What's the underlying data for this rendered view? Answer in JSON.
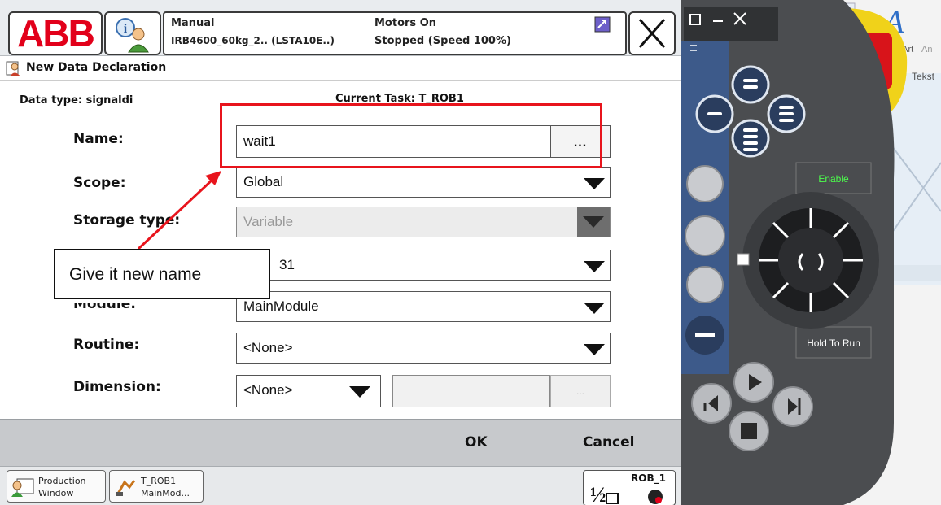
{
  "topbar": {
    "mode": "Manual",
    "robot": "IRB4600_60kg_2.. (LSTA10E..)",
    "motors": "Motors On",
    "state": "Stopped (Speed 100%)"
  },
  "window_title": "New Data Declaration",
  "header": {
    "data_type": "Data type: signaldi",
    "current_task": "Current Task: T_ROB1"
  },
  "form": {
    "name_label": "Name:",
    "name_value": "wait1",
    "name_button": "...",
    "scope_label": "Scope:",
    "scope_value": "Global",
    "storage_label": "Storage type:",
    "storage_value": "Variable",
    "task_value_partial": "31",
    "module_label_partial": "Module:",
    "module_value": "MainModule",
    "routine_label": "Routine:",
    "routine_value": "<None>",
    "dimension_label": "Dimension:",
    "dimension_value": "<None>",
    "dimension_button": "..."
  },
  "buttons": {
    "ok": "OK",
    "cancel": "Cancel"
  },
  "taskbar": {
    "production_l1": "Production",
    "production_l2": "Window",
    "task_l1": "T_ROB1",
    "task_l2": "MainMod...",
    "rob": "ROB_1"
  },
  "annotation": {
    "callout": "Give it new name"
  },
  "flexpendant": {
    "enable": "Enable",
    "hold_to_run": "Hold To Run"
  },
  "background": {
    "text1": "dArt",
    "text2": "An",
    "text3": "Tekst"
  },
  "colors": {
    "abb_red": "#e2001a",
    "highlight_red": "#e8141c",
    "pendant_gray": "#4b4d50",
    "pendant_blue": "#3d5a8a"
  }
}
